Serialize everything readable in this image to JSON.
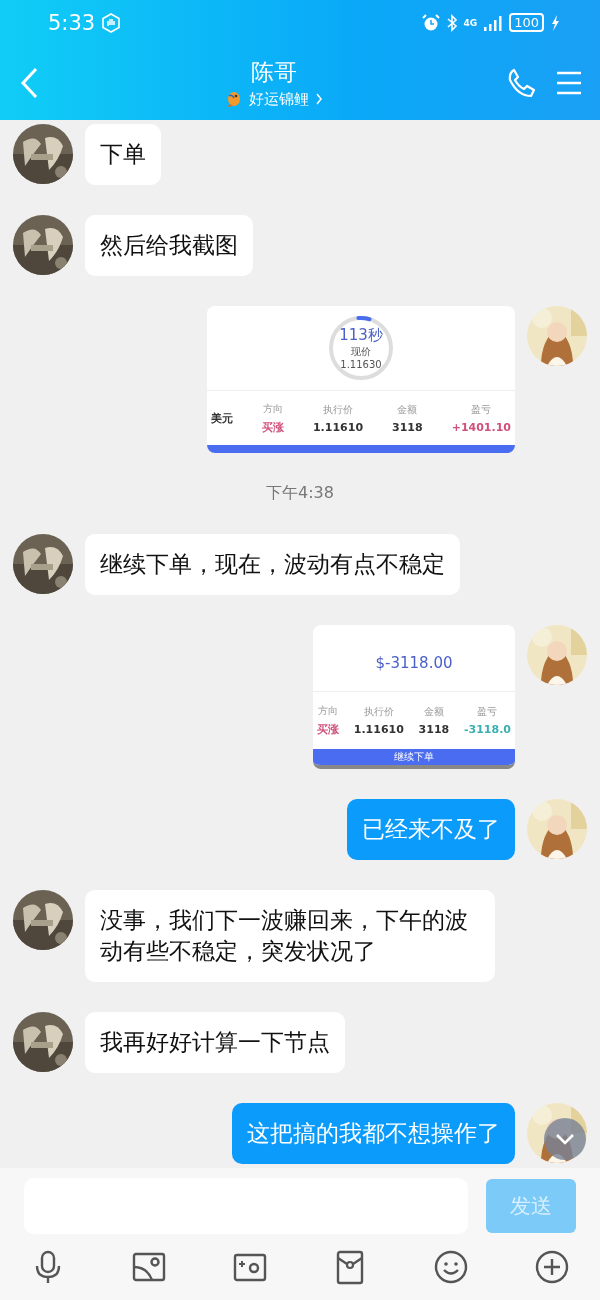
{
  "status_bar": {
    "time": "5:33",
    "network": "4G",
    "battery": "100"
  },
  "header": {
    "title": "陈哥",
    "subtitle": "好运锦鲤"
  },
  "messages": [
    {
      "kind": "incoming",
      "text": "下单"
    },
    {
      "kind": "incoming",
      "text": "然后给我截图"
    },
    {
      "kind": "timershot",
      "timer": "113秒",
      "label": "现价",
      "price": "1.11630",
      "level": 0.06,
      "columns": [
        {
          "value": "美元",
          "color": "#333333"
        },
        {
          "header": "方向",
          "value": "买涨",
          "color": "#d0507a"
        },
        {
          "header": "执行价",
          "value": "1.11610",
          "color": "#333333"
        },
        {
          "header": "金额",
          "value": "3118",
          "color": "#333333"
        },
        {
          "header": "盈亏",
          "value": "+1401.10",
          "color": "#d0507a"
        }
      ]
    },
    {
      "kind": "time",
      "text": "下午4:38"
    },
    {
      "kind": "incoming",
      "text": "继续下单，现在，波动有点不稳定"
    },
    {
      "kind": "resultshot",
      "amount": "$-3118.00",
      "columns": [
        {
          "header": "方向",
          "value": "买涨",
          "color": "#d0507a"
        },
        {
          "header": "执行价",
          "value": "1.11610",
          "color": "#333333"
        },
        {
          "header": "金额",
          "value": "3118",
          "color": "#333333"
        },
        {
          "header": "盈亏",
          "value": "-3118.0",
          "color": "#3ab0b0"
        }
      ],
      "button": "继续下单"
    },
    {
      "kind": "outgoing",
      "text": "已经来不及了"
    },
    {
      "kind": "incoming",
      "text": "没事，我们下一波赚回来，下午的波动有些不稳定，突发状况了"
    },
    {
      "kind": "incoming",
      "text": "我再好好计算一下节点"
    },
    {
      "kind": "outgoing",
      "text": "这把搞的我都不想操作了"
    }
  ],
  "composer": {
    "send": "发送"
  }
}
